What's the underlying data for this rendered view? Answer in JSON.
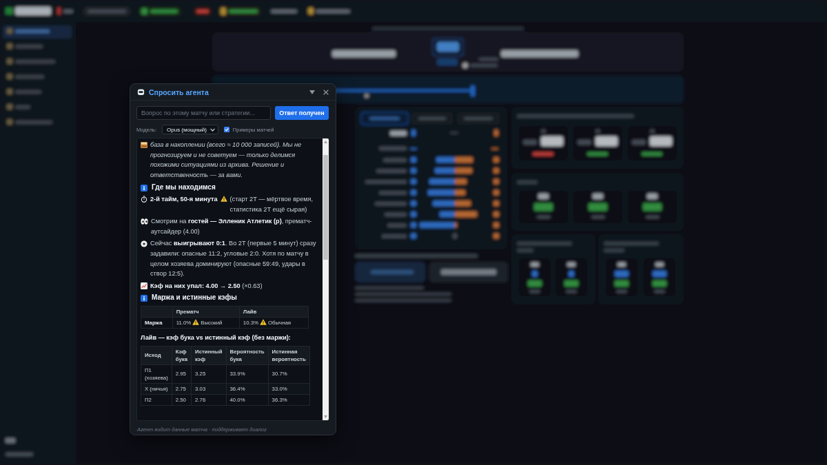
{
  "agent_panel": {
    "title": "Спросить агента",
    "question_field": {
      "placeholder": "Вопрос по этому матчу или стратегии..."
    },
    "submit_button": {
      "label": "Ответ получен"
    },
    "model_select": {
      "label": "Модель:",
      "value": "Opus (мощный)"
    },
    "examples_checkbox": {
      "label": "Примеры матчей",
      "checked": true
    },
    "answer": [
      {
        "kind": "note",
        "text": "база в накоплении (всего ≈ 10 000 записей). Мы не прогнозируем и не советуем — только делимся похожими ситуациями из архива. Решение и ответственность — за вами."
      },
      {
        "kind": "heading",
        "text": "Где мы находимся"
      },
      {
        "kind": "paragraph",
        "lead": "2-й тайм, 50-я минута",
        "warning": true,
        "text": "(старт 2Т — мёртвое время, статистика 2Т ещё сырая)"
      },
      {
        "kind": "paragraph",
        "warning": false,
        "text": "Смотрим на **гостей — Элленик Атлетик (р)**, прематч-аутсайдер (4.00)"
      },
      {
        "kind": "paragraph",
        "warning": false,
        "text": "Сейчас **выигрывают 0:1**. Во 2Т (первые 5 минут) сразу задавили: опасные 11:2, угловые 2:0. Хотя по матчу в целом хозяева доминируют (опасные 59:49, удары в створ 12:5)."
      },
      {
        "kind": "paragraph",
        "warning": false,
        "text": "**Кэф на них упал: 4.00 → 2.50** (×0.63)"
      },
      {
        "kind": "heading",
        "text": "Маржа и истинные кэфы"
      },
      {
        "kind": "table",
        "columns": [
          "Прематч",
          "Лайв"
        ],
        "rows": [
          {
            "label": "Маржа",
            "cells": [
              {
                "text": "11.0%",
                "warning": true,
                "note": "Высокий"
              },
              {
                "text": "10.3%",
                "warning": true,
                "note": "Обычная"
              }
            ]
          }
        ]
      },
      {
        "kind": "caption",
        "text": "Лайв — кэф бука vs истинный кэф (без маржи):"
      },
      {
        "kind": "table",
        "columns": [
          "Исход",
          "Кэф бука",
          "Истинный кэф",
          "Вероятность бука",
          "Истинная вероятность"
        ],
        "rows": [
          {
            "cells": [
              "П1 (хозяева)",
              "2.95",
              "3.25",
              "33.9%",
              "30.7%"
            ]
          },
          {
            "cells": [
              "Х (ничья)",
              "2.75",
              "3.03",
              "36.4%",
              "33.0%"
            ]
          },
          {
            "cells": [
              "П2",
              "2.50",
              "2.76",
              "40.0%",
              "36.3%"
            ]
          }
        ]
      }
    ],
    "footer": "Агент видит данные матча · поддерживает диалог"
  }
}
